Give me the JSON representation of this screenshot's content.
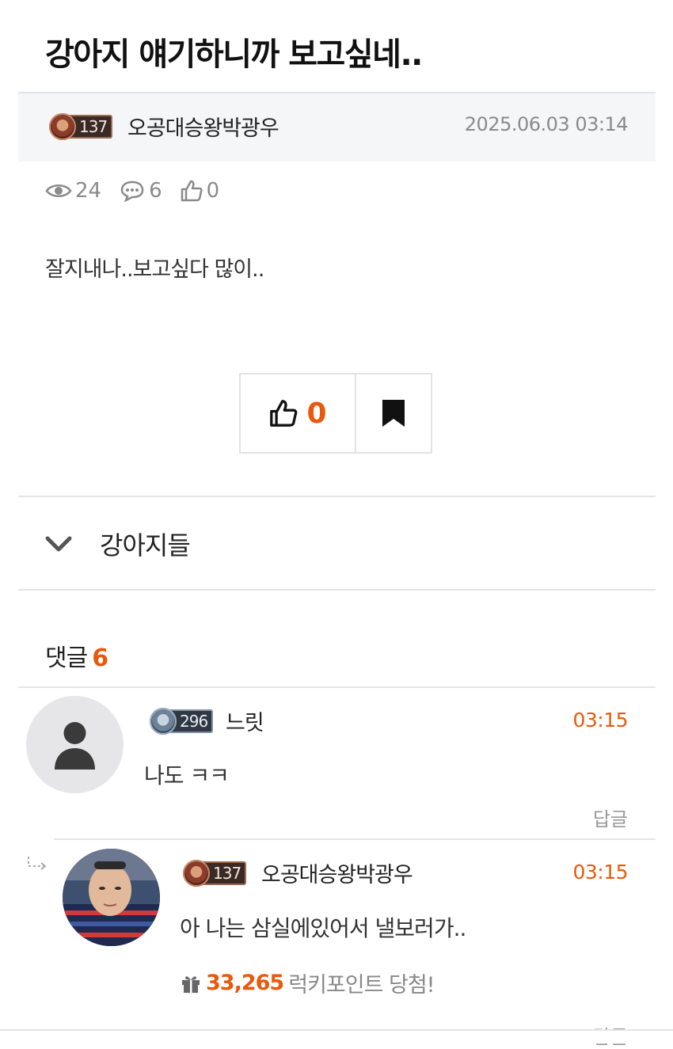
{
  "post": {
    "title": "강아지 얘기하니까 보고싶네..",
    "author": {
      "level": "137",
      "name": "오공대승왕박광우"
    },
    "date": "2025.06.03 03:14",
    "stats": {
      "views": "24",
      "comments": "6",
      "likes": "0"
    },
    "body": "잘지내나..보고싶다 많이..",
    "like_count": "0"
  },
  "category": {
    "label": "강아지들"
  },
  "comments_header": {
    "label": "댓글",
    "count": "6"
  },
  "comments": [
    {
      "level": "296",
      "name": "느릿",
      "time": "03:15",
      "text": "나도 ㅋㅋ",
      "reply_label": "답글"
    },
    {
      "level": "137",
      "name": "오공대승왕박광우",
      "time": "03:15",
      "text": "아 나는 삼실에있어서 낼보러가..",
      "lucky_points": "33,265",
      "lucky_text": "럭키포인트 당첨!",
      "reply_label": "답글"
    }
  ],
  "colors": {
    "accent": "#e8590c",
    "muted": "#8a8a8a"
  }
}
